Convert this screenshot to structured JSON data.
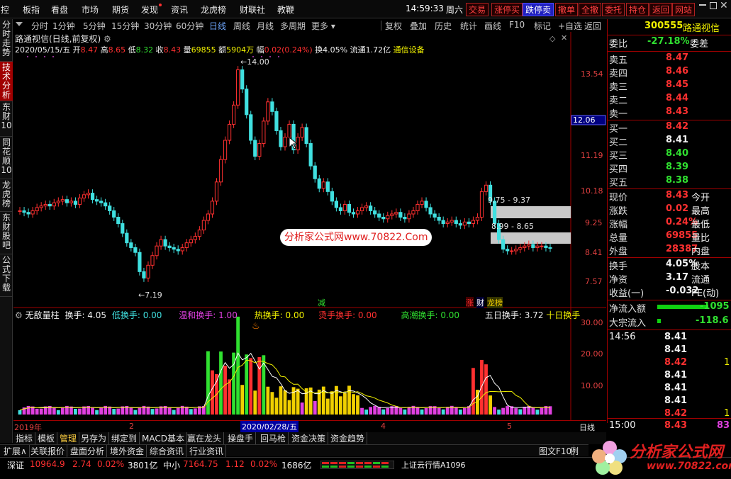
{
  "menu": {
    "items": [
      "控",
      "板指",
      "看盘",
      "市场",
      "期货",
      "发现",
      "资讯",
      "龙虎榜",
      "财联社",
      "教鞭"
    ],
    "time": "14:59:33",
    "weekday": "周六",
    "buttons": [
      "交易",
      "涨停买",
      "跌停卖",
      "撤单",
      "全撤",
      "委托",
      "持仓",
      "返回",
      "网站"
    ]
  },
  "left_tabs": [
    "分时走势",
    "技术分析",
    "东财10",
    "同花顺10",
    "龙虎榜",
    "东财股吧",
    "公式下载"
  ],
  "periods": [
    "分时",
    "1分钟",
    "5分钟",
    "15分钟",
    "30分钟",
    "60分钟",
    "日线",
    "周线",
    "月线",
    "多周期",
    "更多"
  ],
  "right_tools": [
    "复权",
    "叠加",
    "历史",
    "统计",
    "画线",
    "F10",
    "标记",
    "+自选",
    "返回"
  ],
  "stock": {
    "title": "路通视信(日线,前复权)",
    "info_date": "2020/05/15/五",
    "info_open_lab": "开",
    "info_open": "8.47",
    "info_high_lab": "高",
    "info_high": "8.65",
    "info_low_lab": "低",
    "info_low": "8.32",
    "info_close_lab": "收",
    "info_close": "8.43",
    "info_vol_lab": "量",
    "info_vol": "69855",
    "info_amt_lab": "额",
    "info_amt": "5904万",
    "info_chg_lab": "幅",
    "info_chg": "0.02(0.24%)",
    "info_turn": "换4.05%",
    "info_float": "流通1.72亿",
    "info_sector": "通信设备"
  },
  "price_axis": [
    "13.54",
    "12.06",
    "11.19",
    "10.18",
    "9.25",
    "8.41",
    "7.57"
  ],
  "annotations": {
    "high": "14.00",
    "low": "7.19",
    "zone1": "9.75 - 9.37",
    "zone2": "8.99 - 8.65",
    "watermark": "分析家公式网www.70822.Com",
    "tag_jian": "减",
    "tag_zhang": "涨",
    "tag_cai": "财",
    "tag_long": "龙榜"
  },
  "indicator": {
    "name": "无敌量柱",
    "huanshou": "换手: 4.05",
    "di": "低换手: 0.00",
    "wen": "温和换手: 1.00",
    "re": "热换手: 0.00",
    "tang": "烫手换手: 0.00",
    "gao": "高潮换手: 0.00",
    "wu": "五日换手: 3.72",
    "shi": "十日换手",
    "axis": [
      "30.00",
      "20.00",
      "10.00"
    ]
  },
  "time_axis": {
    "y2019": "2019年",
    "m2": "2",
    "cursor": "2020/02/28/五",
    "m4": "4",
    "m5": "5",
    "period": "日线"
  },
  "bottom_tabs1": [
    "指标",
    "模板",
    "管理",
    "另存为",
    "绑定到",
    "MACD基本",
    "赢在龙头",
    "操盘手",
    "回马枪",
    "资金决策",
    "资金趋势"
  ],
  "bottom_tabs2": [
    "扩展∧",
    "关联报价",
    "盘面分析",
    "境外资金",
    "综合资讯",
    "行业资讯"
  ],
  "bottom_right": [
    "图文F10",
    "例边"
  ],
  "right_panel": {
    "code": "300555",
    "name": "路通视信",
    "weibi_lab": "委比",
    "weibi": "-27.18%",
    "weicha_lab": "委差",
    "sells": [
      [
        "卖五",
        "8.47"
      ],
      [
        "卖四",
        "8.46"
      ],
      [
        "卖三",
        "8.45"
      ],
      [
        "卖二",
        "8.44"
      ],
      [
        "卖一",
        "8.43"
      ]
    ],
    "buys": [
      [
        "买一",
        "8.42"
      ],
      [
        "买二",
        "8.41"
      ],
      [
        "买三",
        "8.40"
      ],
      [
        "买四",
        "8.39"
      ],
      [
        "买五",
        "8.38"
      ]
    ],
    "stats": [
      [
        "现价",
        "8.43",
        "今开"
      ],
      [
        "涨跌",
        "0.02",
        "最高"
      ],
      [
        "涨幅",
        "0.24%",
        "最低"
      ],
      [
        "总量",
        "69855",
        "量比"
      ],
      [
        "外盘",
        "28387",
        "内盘"
      ]
    ],
    "stats2": [
      [
        "换手",
        "4.05%",
        "股本"
      ],
      [
        "净资",
        "3.17",
        "流通"
      ],
      [
        "收益(一)",
        "-0.032",
        "PE(动)"
      ]
    ],
    "flow1_lab": "净流入额",
    "flow1": "-1095",
    "flow2_lab": "大宗流入",
    "flow2": "-118.6",
    "ticks": [
      [
        "14:56",
        "8.41",
        ""
      ],
      [
        "",
        "8.41",
        ""
      ],
      [
        "",
        "8.42",
        "1"
      ],
      [
        "",
        "8.41",
        ""
      ],
      [
        "",
        "8.41",
        ""
      ],
      [
        "",
        "8.41",
        ""
      ],
      [
        "",
        "8.42",
        "1"
      ]
    ],
    "last_time": "15:00",
    "last_price": "8.43",
    "last_vol": "83"
  },
  "status": {
    "sz_lab": "深证",
    "sz": "10964.9",
    "sz_chg": "2.74",
    "sz_pct": "0.02%",
    "sz_amt": "3801亿",
    "zx_lab": "中小",
    "zx": "7164.75",
    "zx_chg": "1.12",
    "zx_pct": "0.02%",
    "zx_amt": "1686亿",
    "cloud": "上证云行情A1096"
  },
  "logo": {
    "text": "分析家公式网",
    "url": "www.70822.com"
  },
  "chart_data": {
    "type": "candlestick",
    "note": "daily candles, front-adjusted",
    "ylim": [
      7.0,
      14.3
    ]
  }
}
